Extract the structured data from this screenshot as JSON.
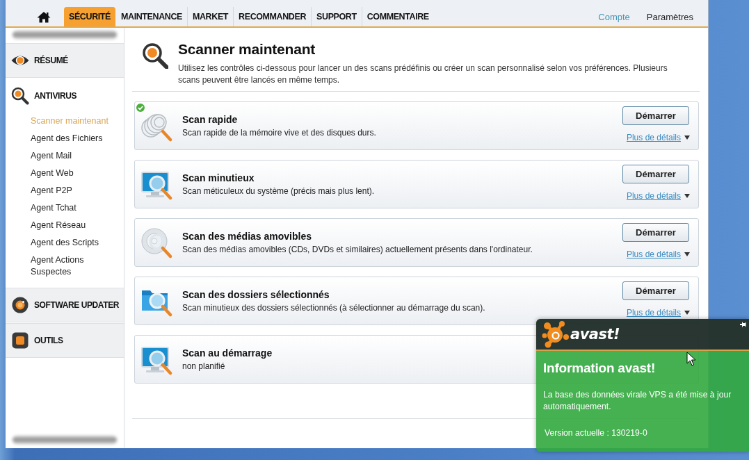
{
  "nav": {
    "tabs": [
      {
        "label": "SÉCURITÉ",
        "selected": true
      },
      {
        "label": "MAINTENANCE",
        "selected": false
      },
      {
        "label": "MARKET",
        "selected": false
      },
      {
        "label": "RECOMMANDER",
        "selected": false
      },
      {
        "label": "SUPPORT",
        "selected": false
      },
      {
        "label": "COMMENTAIRE",
        "selected": false
      }
    ],
    "links": [
      {
        "label": "Compte",
        "highlighted": true
      },
      {
        "label": "Paramètres",
        "highlighted": false
      }
    ]
  },
  "sidebar": {
    "sections": [
      {
        "label": "RÉSUMÉ",
        "expanded": false
      },
      {
        "label": "ANTIVIRUS",
        "expanded": true,
        "items": [
          {
            "label": "Scanner maintenant",
            "selected": true
          },
          {
            "label": "Agent des Fichiers",
            "selected": false
          },
          {
            "label": "Agent Mail",
            "selected": false
          },
          {
            "label": "Agent Web",
            "selected": false
          },
          {
            "label": "Agent P2P",
            "selected": false
          },
          {
            "label": "Agent Tchat",
            "selected": false
          },
          {
            "label": "Agent Réseau",
            "selected": false
          },
          {
            "label": "Agent des Scripts",
            "selected": false
          },
          {
            "label": "Agent Actions Suspectes",
            "selected": false
          }
        ]
      },
      {
        "label": "SOFTWARE UPDATER",
        "expanded": false
      },
      {
        "label": "OUTILS",
        "expanded": false
      }
    ]
  },
  "page": {
    "title": "Scanner maintenant",
    "description": "Utilisez les contrôles ci-dessous pour lancer un des scans prédéfinis ou créer un scan personnalisé selon vos préférences. Plusieurs scans peuvent être lancés en même temps."
  },
  "scans": [
    {
      "title": "Scan rapide",
      "description": "Scan rapide de la mémoire vive et des disques durs.",
      "done": true,
      "button": "Démarrer",
      "details_link": "Plus de détails"
    },
    {
      "title": "Scan minutieux",
      "description": "Scan méticuleux du système (précis mais plus lent).",
      "done": false,
      "button": "Démarrer",
      "details_link": "Plus de détails"
    },
    {
      "title": "Scan des médias amovibles",
      "description": "Scan des médias amovibles (CDs, DVDs et similaires) actuellement présents dans l'ordinateur.",
      "done": false,
      "button": "Démarrer",
      "details_link": "Plus de détails"
    },
    {
      "title": "Scan des dossiers sélectionnés",
      "description": "Scan minutieux des dossiers sélectionnés (à sélectionner au démarrage du scan).",
      "done": false,
      "button": "Démarrer",
      "details_link": "Plus de détails"
    },
    {
      "title": "Scan au démarrage",
      "description": "non planifié",
      "done": false
    }
  ],
  "notification": {
    "brand": "avast!",
    "title": "Information avast!",
    "message": "La base des données virale VPS a été mise à jour automatiquement.",
    "version": "Version actuelle : 130219-0"
  }
}
